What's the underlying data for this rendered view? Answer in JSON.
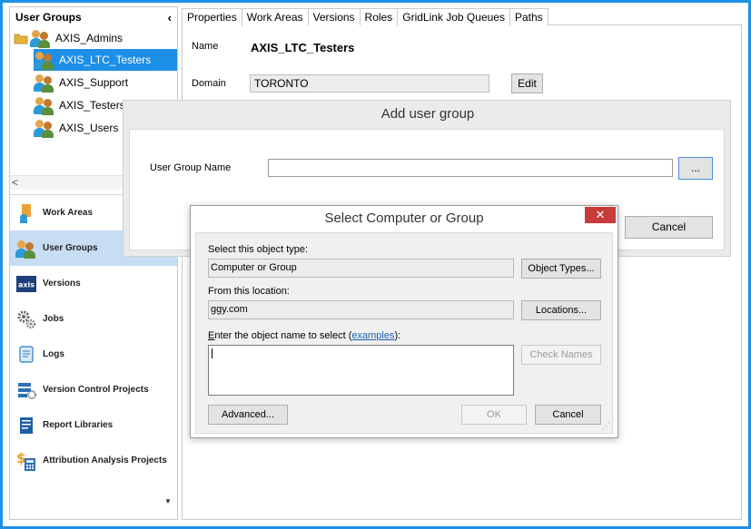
{
  "left_panel": {
    "header": "User Groups",
    "collapse_glyph": "‹",
    "tree": [
      {
        "label": "AXIS_Admins",
        "icon": "users-folder-icon"
      },
      {
        "label": "AXIS_LTC_Testers",
        "icon": "users-icon",
        "selected": true
      },
      {
        "label": "AXIS_Support",
        "icon": "users-icon"
      },
      {
        "label": "AXIS_Testers",
        "icon": "users-icon"
      },
      {
        "label": "AXIS_Users",
        "icon": "users-icon"
      }
    ],
    "nav": [
      {
        "label": "Work Areas",
        "icon": "work-areas-icon"
      },
      {
        "label": "User Groups",
        "icon": "user-groups-icon",
        "active": true
      },
      {
        "label": "Versions",
        "icon": "axis-versions-icon"
      },
      {
        "label": "Jobs",
        "icon": "gears-icon"
      },
      {
        "label": "Logs",
        "icon": "scroll-icon"
      },
      {
        "label": "Version Control Projects",
        "icon": "version-control-icon"
      },
      {
        "label": "Report Libraries",
        "icon": "report-library-icon"
      },
      {
        "label": "Attribution Analysis Projects",
        "icon": "dollar-calculator-icon"
      }
    ],
    "scroll_left_glyph": "<",
    "more_glyph": "▼"
  },
  "tabs": [
    "Properties",
    "Work Areas",
    "Versions",
    "Roles",
    "GridLink Job Queues",
    "Paths"
  ],
  "properties": {
    "name_label": "Name",
    "name_value": "AXIS_LTC_Testers",
    "domain_label": "Domain",
    "domain_value": "TORONTO",
    "edit_button": "Edit"
  },
  "add_user_group": {
    "title": "Add user group",
    "field_label": "User Group Name",
    "field_value": "",
    "browse_button": "...",
    "cancel_button": "Cancel"
  },
  "select_dialog": {
    "title": "Select Computer or Group",
    "close_glyph": "✕",
    "object_type_label": "Select this object type:",
    "object_type_value": "Computer or Group",
    "object_types_button": "Object Types...",
    "location_label": "From this location:",
    "location_value": "ggy.com",
    "locations_button": "Locations...",
    "enter_label_prefix": "nter the object name to select (",
    "enter_label_mnemonic": "E",
    "enter_label_link": "examples",
    "enter_label_suffix": "):",
    "check_names_button": "Check Names",
    "advanced_button": "Advanced...",
    "ok_button": "OK",
    "cancel_button": "Cancel"
  },
  "colors": {
    "frame": "#1e8fe6",
    "selection": "#1e8fe6",
    "nav_active": "#c7ddf4",
    "close_button": "#c93a3a",
    "link": "#1a5fb4"
  }
}
